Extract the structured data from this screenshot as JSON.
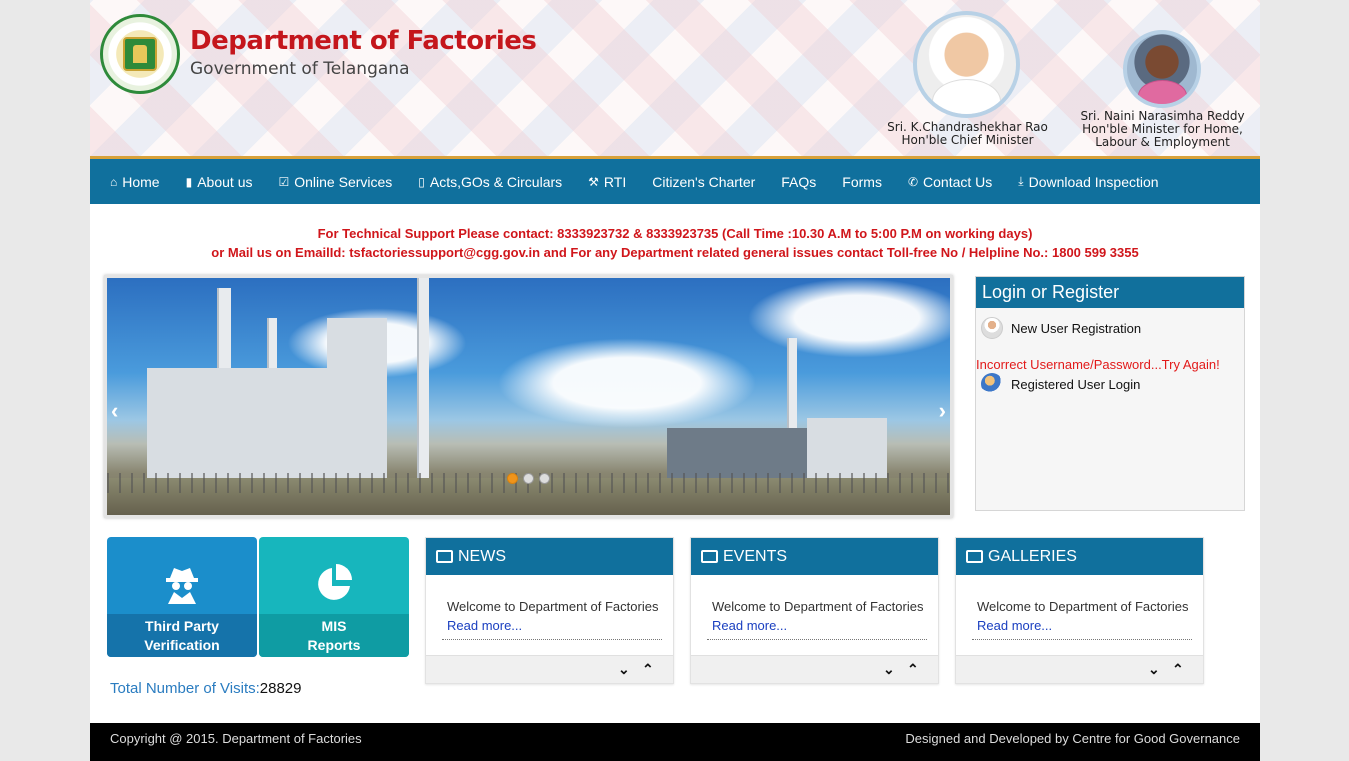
{
  "header": {
    "title": "Department of Factories",
    "subtitle": "Government of Telangana",
    "people": [
      {
        "name": "Sri. K.Chandrashekhar Rao",
        "role": "Hon'ble Chief Minister"
      },
      {
        "name": "Sri. Naini Narasimha Reddy",
        "role": "Hon'ble Minister for Home,",
        "role2": "Labour & Employment"
      }
    ]
  },
  "nav": {
    "items": [
      {
        "label": "Home",
        "icon": "home-icon"
      },
      {
        "label": "About us",
        "icon": "book-icon"
      },
      {
        "label": "Online Services",
        "icon": "checkbox-icon"
      },
      {
        "label": "Acts,GOs & Circulars",
        "icon": "file-icon"
      },
      {
        "label": "RTI",
        "icon": "gavel-icon"
      },
      {
        "label": "Citizen's Charter"
      },
      {
        "label": "FAQs"
      },
      {
        "label": "Forms"
      },
      {
        "label": "Contact Us",
        "icon": "phone-icon"
      },
      {
        "label": "Download Inspection",
        "icon": "download-icon"
      }
    ]
  },
  "support": {
    "line1": "For Technical Support Please contact: 8333923732 & 8333923735 (Call Time :10.30 A.M to 5:00 P.M on working days)",
    "line2": "or Mail us on EmailId: tsfactoriessupport@cgg.gov.in and For any Department related general issues contact Toll-free No / Helpline No.: 1800 599 3355"
  },
  "slider": {
    "prev": "‹",
    "next": "›",
    "slides": 3,
    "active": 1
  },
  "login": {
    "title": "Login or Register",
    "new_user": "New User Registration",
    "error": "Incorrect Username/Password...Try Again!",
    "registered": "Registered User Login"
  },
  "tiles": [
    {
      "line1": "Third Party",
      "line2": "Verification",
      "icon": "spy-icon"
    },
    {
      "line1": "MIS",
      "line2": "Reports",
      "icon": "pie-chart-icon"
    }
  ],
  "visits": {
    "label": "Total Number of Visits:",
    "count": "28829"
  },
  "panels": [
    {
      "title": "NEWS",
      "text": "Welcome to Department of Factories",
      "more": "Read more..."
    },
    {
      "title": "EVENTS",
      "text": "Welcome to Department of Factories",
      "more": "Read more..."
    },
    {
      "title": "GALLERIES",
      "text": "Welcome to Department of Factories",
      "more": "Read more..."
    }
  ],
  "footer": {
    "left": "Copyright @ 2015. Department of Factories",
    "right": "Designed and Developed by Centre for Good Governance"
  },
  "colors": {
    "brand_blue": "#10709d",
    "title_red": "#c4161c",
    "alert_red": "#e21a1a"
  }
}
